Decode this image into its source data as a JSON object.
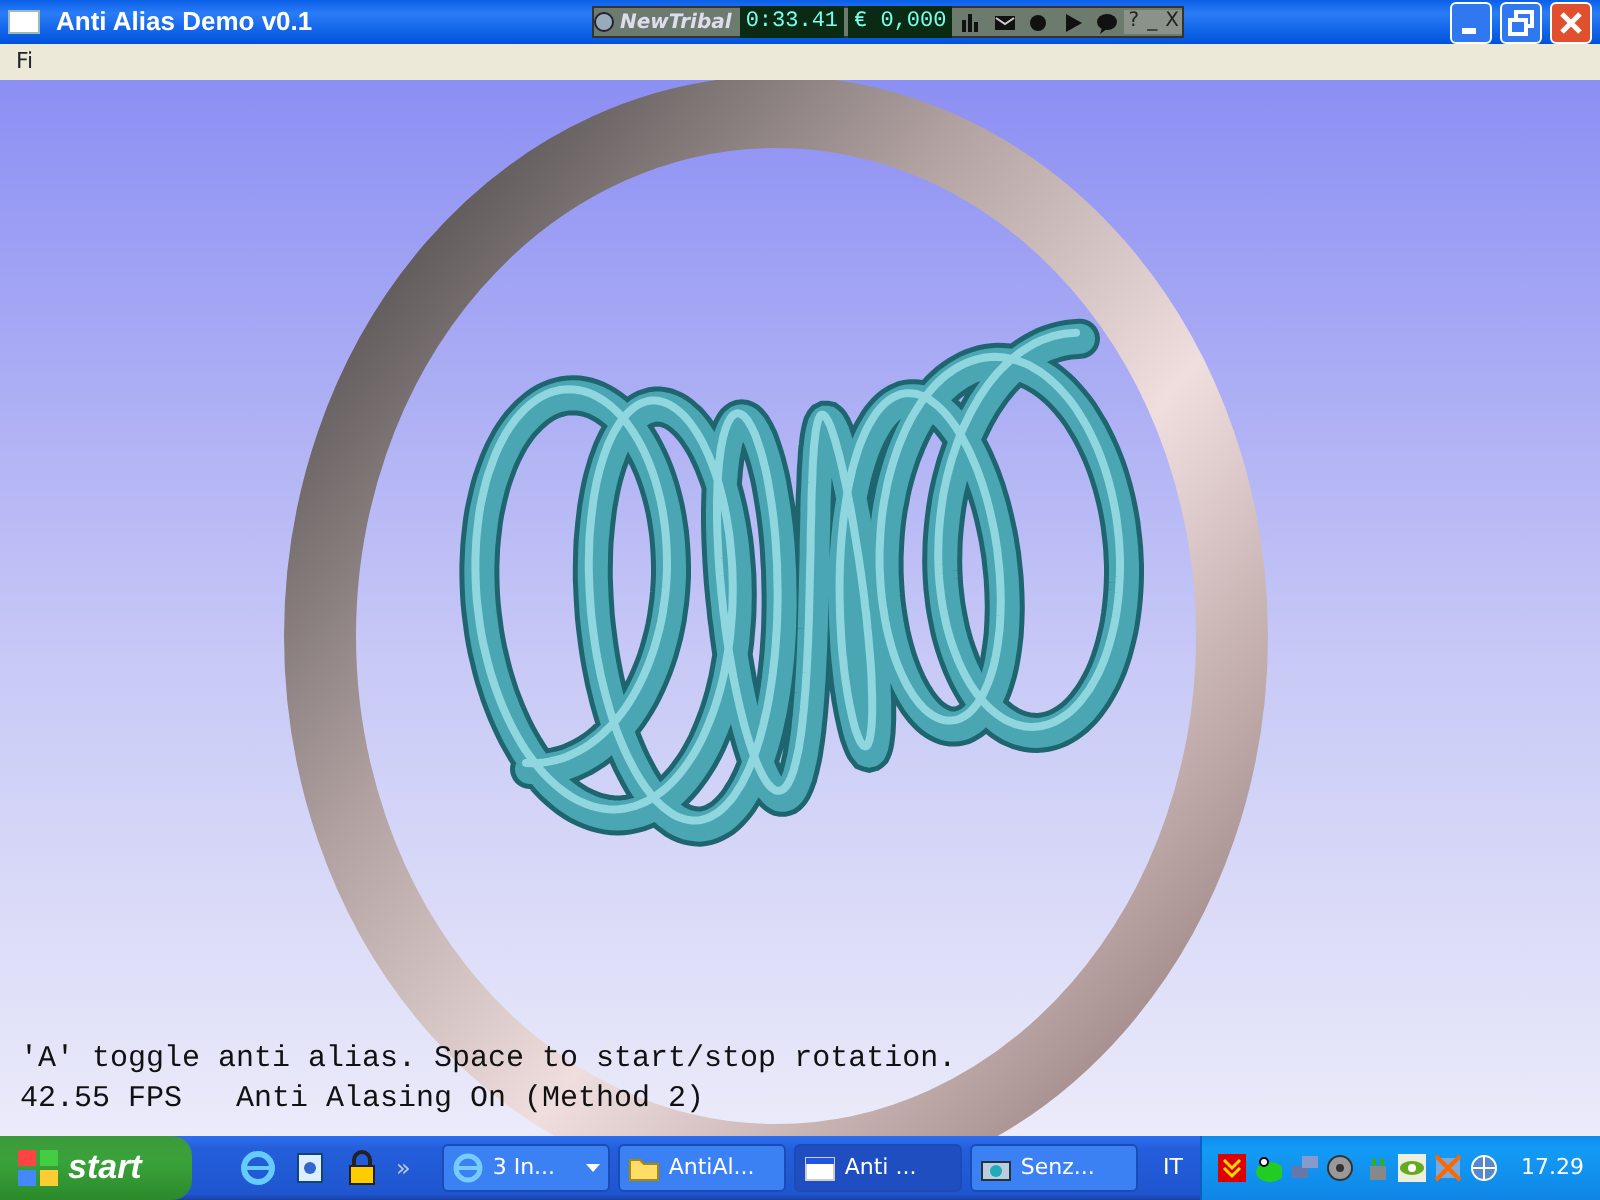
{
  "window": {
    "title": "Anti Alias Demo v0.1",
    "menu": [
      "Fi"
    ]
  },
  "toolbar": {
    "brand": "NewTribal",
    "timer": "0:33.41",
    "credit": "€ 0,000",
    "help": "?",
    "minimize": "_",
    "close": "X"
  },
  "viewport": {
    "lines": [
      "'A' toggle anti alias. Space to start/stop rotation.",
      "42.55 FPS   Anti Alasing On (Method 2)"
    ]
  },
  "taskbar": {
    "start": "start",
    "quick_launch_more": "»",
    "tasks": [
      {
        "label": "3 In...",
        "kind": "browser",
        "selected": false,
        "dropdown": true
      },
      {
        "label": "AntiAl...",
        "kind": "folder",
        "selected": false,
        "dropdown": false
      },
      {
        "label": "Anti ...",
        "kind": "window",
        "selected": true,
        "dropdown": false
      },
      {
        "label": "Senz...",
        "kind": "camera",
        "selected": false,
        "dropdown": false
      }
    ],
    "language": "IT",
    "clock": "17.29"
  }
}
